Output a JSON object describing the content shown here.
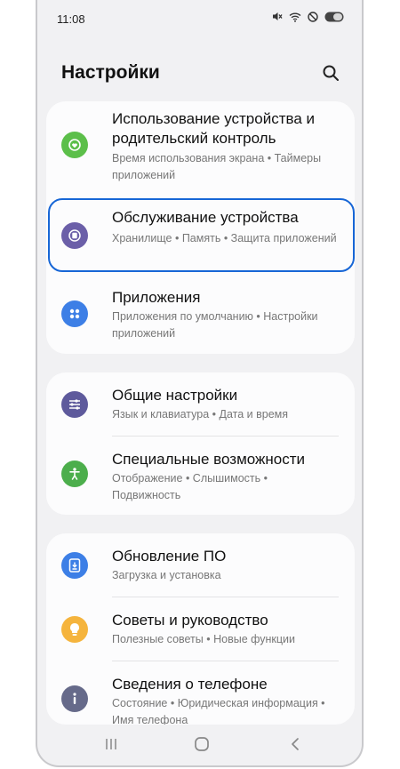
{
  "status_bar": {
    "time": "11:08"
  },
  "header": {
    "title": "Настройки"
  },
  "groups": [
    {
      "items": [
        {
          "title": "Использование устройства и родительский контроль",
          "subtitle": "Время использования экрана • Таймеры приложений",
          "icon": "digital-wellbeing-icon",
          "icon_color": "#5cbf4a"
        },
        {
          "title": "Обслуживание устройства",
          "subtitle": "Хранилище • Память • Защита приложений",
          "icon": "device-care-icon",
          "icon_color": "#6b5fa8",
          "highlighted": true
        },
        {
          "title": "Приложения",
          "subtitle": "Приложения по умолчанию • Настройки приложений",
          "icon": "apps-icon",
          "icon_color": "#3d7fe6"
        }
      ]
    },
    {
      "items": [
        {
          "title": "Общие настройки",
          "subtitle": "Язык и клавиатура • Дата и время",
          "icon": "general-management-icon",
          "icon_color": "#5e5a9c"
        },
        {
          "title": "Специальные возможности",
          "subtitle": "Отображение • Слышимость • Подвижность",
          "icon": "accessibility-icon",
          "icon_color": "#4cae4c"
        }
      ]
    },
    {
      "items": [
        {
          "title": "Обновление ПО",
          "subtitle": "Загрузка и установка",
          "icon": "software-update-icon",
          "icon_color": "#3d7fe6"
        },
        {
          "title": "Советы и руководство",
          "subtitle": "Полезные советы • Новые функции",
          "icon": "tips-icon",
          "icon_color": "#f5b43d"
        },
        {
          "title": "Сведения о телефоне",
          "subtitle": "Состояние • Юридическая информация • Имя телефона",
          "icon": "about-phone-icon",
          "icon_color": "#666a8a"
        }
      ]
    }
  ],
  "highlight_color": "#1766d6"
}
